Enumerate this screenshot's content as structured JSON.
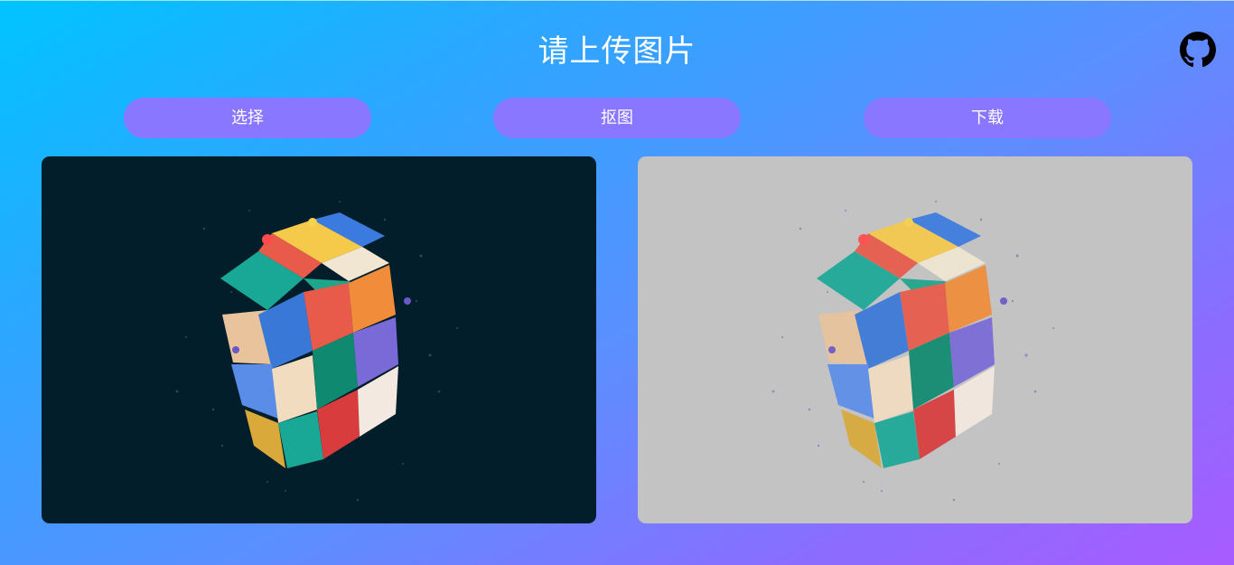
{
  "header": {
    "title": "请上传图片"
  },
  "toolbar": {
    "select_label": "选择",
    "matting_label": "抠图",
    "download_label": "下载"
  },
  "icons": {
    "github": "github-icon"
  },
  "colors": {
    "button_bg": "#8a77ff",
    "original_bg": "#021e2b",
    "result_bg": "#c3c3c3"
  }
}
